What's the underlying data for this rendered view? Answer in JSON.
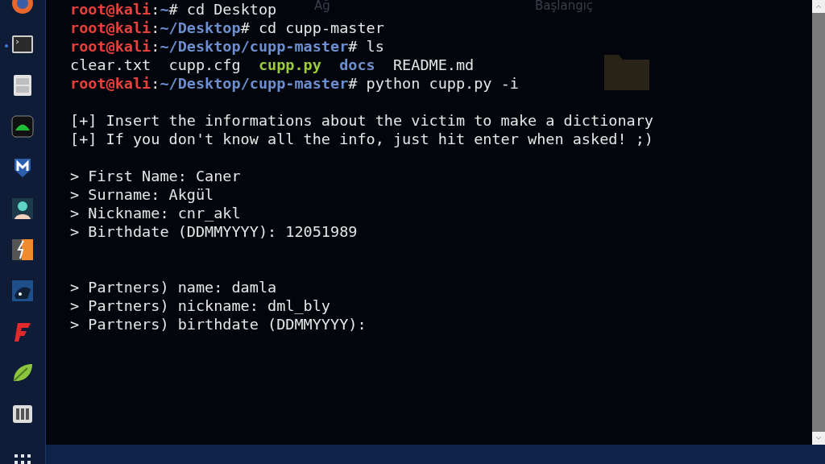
{
  "desktop": {
    "icons": [
      {
        "label": "Ağ"
      },
      {
        "label": "Başlangıç"
      }
    ]
  },
  "terminal": {
    "lines": [
      {
        "kind": "text",
        "segments": [
          {
            "kind": "user",
            "text": "root@kali"
          },
          {
            "kind": "plain",
            "text": ":"
          },
          {
            "kind": "path",
            "text": "~"
          },
          {
            "kind": "plain",
            "text": "# cd Desktop"
          }
        ]
      },
      {
        "kind": "text",
        "segments": [
          {
            "kind": "user",
            "text": "root@kali"
          },
          {
            "kind": "plain",
            "text": ":"
          },
          {
            "kind": "path",
            "text": "~/Desktop"
          },
          {
            "kind": "plain",
            "text": "# cd cupp-master"
          }
        ]
      },
      {
        "kind": "text",
        "segments": [
          {
            "kind": "user",
            "text": "root@kali"
          },
          {
            "kind": "plain",
            "text": ":"
          },
          {
            "kind": "path",
            "text": "~/Desktop/cupp-master"
          },
          {
            "kind": "plain",
            "text": "# ls"
          }
        ]
      },
      {
        "kind": "text",
        "segments": [
          {
            "kind": "plain",
            "text": "clear.txt  cupp.cfg  "
          },
          {
            "kind": "exec",
            "text": "cupp.py"
          },
          {
            "kind": "dir",
            "text": "  docs"
          },
          {
            "kind": "plain",
            "text": "  README.md"
          }
        ]
      },
      {
        "kind": "text",
        "segments": [
          {
            "kind": "user",
            "text": "root@kali"
          },
          {
            "kind": "plain",
            "text": ":"
          },
          {
            "kind": "path",
            "text": "~/Desktop/cupp-master"
          },
          {
            "kind": "plain",
            "text": "# python cupp.py -i"
          }
        ]
      },
      {
        "kind": "blank"
      },
      {
        "kind": "text",
        "segments": [
          {
            "kind": "plain",
            "text": "[+] Insert the informations about the victim to make a dictionary"
          }
        ]
      },
      {
        "kind": "text",
        "segments": [
          {
            "kind": "plain",
            "text": "[+] If you don't know all the info, just hit enter when asked! ;)"
          }
        ]
      },
      {
        "kind": "blank"
      },
      {
        "kind": "text",
        "segments": [
          {
            "kind": "plain",
            "text": "> First Name: Caner"
          }
        ]
      },
      {
        "kind": "text",
        "segments": [
          {
            "kind": "plain",
            "text": "> Surname: Akgül"
          }
        ]
      },
      {
        "kind": "text",
        "segments": [
          {
            "kind": "plain",
            "text": "> Nickname: cnr_akl"
          }
        ]
      },
      {
        "kind": "text",
        "segments": [
          {
            "kind": "plain",
            "text": "> Birthdate (DDMMYYYY): 12051989"
          }
        ]
      },
      {
        "kind": "blank"
      },
      {
        "kind": "blank"
      },
      {
        "kind": "text",
        "segments": [
          {
            "kind": "plain",
            "text": "> Partners) name: damla"
          }
        ]
      },
      {
        "kind": "text",
        "segments": [
          {
            "kind": "plain",
            "text": "> Partners) nickname: dml_bly"
          }
        ]
      },
      {
        "kind": "text",
        "segments": [
          {
            "kind": "plain",
            "text": "> Partners) birthdate (DDMMYYYY):"
          }
        ]
      }
    ]
  }
}
